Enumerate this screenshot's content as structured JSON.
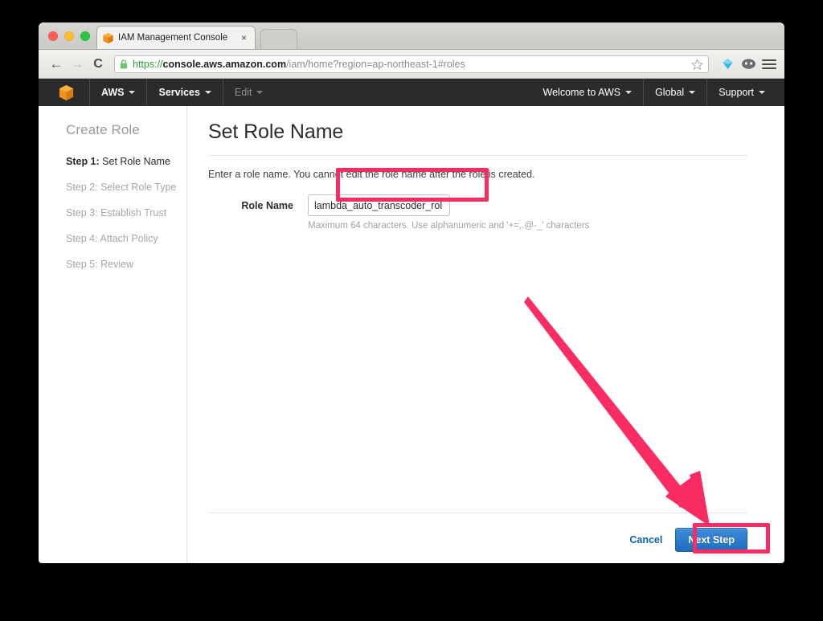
{
  "browser": {
    "tab": {
      "title": "IAM Management Console",
      "favicon": "aws-cube-icon",
      "close_label": "×"
    },
    "toolbar": {
      "back_label": "←",
      "forward_label": "→",
      "reload_label": "C",
      "url_scheme": "https://",
      "url_host": "console.aws.amazon.com",
      "url_path": "/iam/home?region=ap-northeast-1#roles",
      "url_full": "https://console.aws.amazon.com/iam/home?region=ap-northeast-1#roles",
      "lock_icon": "secure-lock-icon",
      "star_icon": "bookmark-star-icon",
      "extension_one": "blue-diamond-extension-icon",
      "extension_two": "dark-oval-extension-icon",
      "menu_icon": "hamburger-menu-icon"
    }
  },
  "aws_nav": {
    "logo": "aws-cube-logo",
    "left_items": [
      {
        "label": "AWS",
        "caret": true,
        "dim": false
      },
      {
        "label": "Services",
        "caret": true,
        "dim": false
      },
      {
        "label": "Edit",
        "caret": true,
        "dim": true
      }
    ],
    "right_items": [
      {
        "label": "Welcome to AWS",
        "caret": true
      },
      {
        "label": "Global",
        "caret": true
      },
      {
        "label": "Support",
        "caret": true
      }
    ]
  },
  "sidebar": {
    "title": "Create Role",
    "steps": [
      {
        "num": "Step 1:",
        "label": " Set Role Name",
        "active": true
      },
      {
        "num": "Step 2:",
        "label": " Select Role Type",
        "active": false
      },
      {
        "num": "Step 3:",
        "label": " Establish Trust",
        "active": false
      },
      {
        "num": "Step 4:",
        "label": " Attach Policy",
        "active": false
      },
      {
        "num": "Step 5:",
        "label": " Review",
        "active": false
      }
    ]
  },
  "main": {
    "heading": "Set Role Name",
    "intro": "Enter a role name. You cannot edit the role name after the role is created.",
    "role_name_label": "Role Name",
    "role_name_value": "lambda_auto_transcoder_rol",
    "role_name_placeholder": "",
    "role_name_hint": "Maximum 64 characters. Use alphanumeric and '+=,.@-_' characters",
    "cancel_label": "Cancel",
    "next_step_label": "Next Step"
  },
  "annotations": {
    "highlight_color": "#fa2d62",
    "arrow_name": "pink-pointer-arrow",
    "arrow_from": "656,372",
    "arrow_to": "882,654",
    "boxes": [
      {
        "name": "role-name-input-highlight"
      },
      {
        "name": "next-step-button-highlight"
      }
    ]
  },
  "colors": {
    "accent_blue": "#2f7dd0",
    "link_blue": "#0f62b6",
    "nav_dark": "#2b2b2b",
    "aws_orange": "#f19021",
    "highlight_pink": "#fa2d62"
  }
}
